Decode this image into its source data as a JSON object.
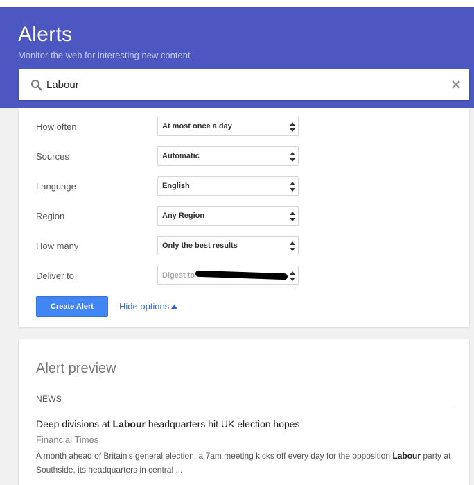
{
  "header": {
    "title": "Alerts",
    "subtitle": "Monitor the web for interesting new content",
    "background_color": "#4c57c2"
  },
  "search": {
    "value": "Labour",
    "search_icon": "search-icon",
    "clear_icon": "close-icon"
  },
  "options": {
    "rows": [
      {
        "label": "How often",
        "value": "At most once a day"
      },
      {
        "label": "Sources",
        "value": "Automatic"
      },
      {
        "label": "Language",
        "value": "English"
      },
      {
        "label": "Region",
        "value": "Any Region"
      },
      {
        "label": "How many",
        "value": "Only the best results"
      },
      {
        "label": "Deliver to",
        "value": "Digest to"
      }
    ],
    "create_button": "Create Alert",
    "hide_options": "Hide options",
    "accent_color": "#4285f4"
  },
  "preview": {
    "title": "Alert preview",
    "section": "NEWS",
    "article": {
      "title_before": "Deep divisions at ",
      "title_highlight": "Labour",
      "title_after": " headquarters hit UK election hopes",
      "source": "Financial Times",
      "snippet_before": "A month ahead of Britain's general election, a 7am meeting kicks off every day for the opposition ",
      "snippet_highlight": "Labour",
      "snippet_after": " party at Southside, its headquarters in central ..."
    }
  }
}
